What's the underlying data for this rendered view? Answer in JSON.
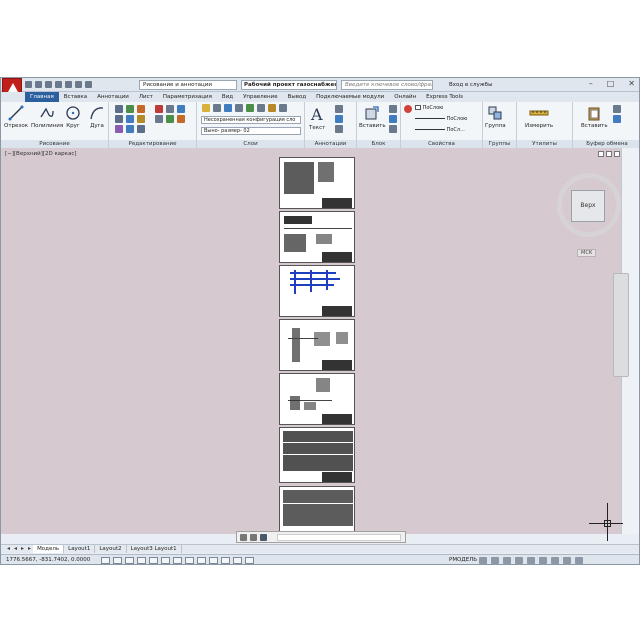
{
  "window": {
    "workspace": "Рисование и аннотации",
    "doc_title": "Рабочий проект газоснабжения...",
    "search_placeholder": "Введите ключевое слово/фразу",
    "login": "Вход в службы"
  },
  "ribbon": {
    "tabs": [
      "Главная",
      "Вставка",
      "Аннотации",
      "Лист",
      "Параметризация",
      "Вид",
      "Управление",
      "Вывод",
      "Подключаемые модули",
      "Онлайн",
      "Express Tools"
    ],
    "active_tab": "Главная",
    "draw_tools": [
      "Отрезок",
      "Полилиния",
      "Круг",
      "Дуга"
    ],
    "panels": {
      "draw": "Рисование",
      "edit": "Редактирование",
      "layers": "Слои",
      "annotation": "Аннотации",
      "block": "Блок",
      "properties": "Свойства",
      "groups": "Группы",
      "utilities": "Утилиты",
      "clipboard": "Буфер обмена"
    },
    "layer_state": "Несохраненная конфигурация сло",
    "current_layer": "Выно- размер- 02",
    "text_tool": "Текст",
    "insert_tool": "Вставить",
    "bylayer_color": "ПоСлою",
    "bylayer_linetype": "ПоСлою",
    "bylayer_lineweight": "ПоСл...",
    "group_tool": "Группа",
    "measure_tool": "Измерить",
    "paste_tool": "Вставить"
  },
  "viewport": {
    "label": "[−][Верхний][2D каркас]"
  },
  "viewcube": {
    "face": "Верх",
    "ucs": "МСК"
  },
  "layout_tabs": [
    "Модель",
    "Layout1",
    "Layout2",
    "Layout3 Layout1"
  ],
  "active_layout": "Модель",
  "statusbar": {
    "coords": "1776.5667, -831.7402, 0.0000",
    "space": "РМОДЕЛЬ"
  },
  "colors": {
    "canvas": "#d6c9cf",
    "app_button": "#c0201c",
    "active_tab": "#2b5f9e"
  }
}
